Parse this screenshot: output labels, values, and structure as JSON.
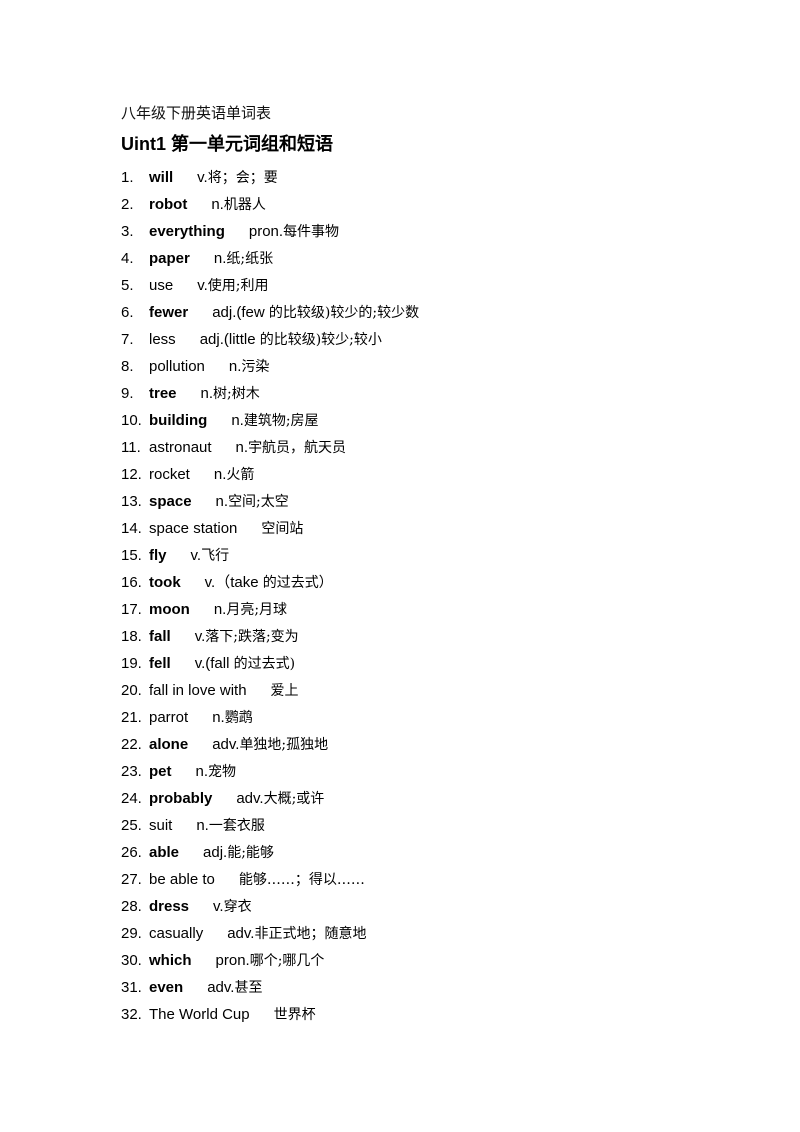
{
  "document": {
    "title": "八年级下册英语单词表",
    "unit_title_en": "Uint1",
    "unit_title_zh": "第一单元词组和短语",
    "entries": [
      {
        "num": "1.",
        "word": "will",
        "bold": true,
        "pos": "v.",
        "meaning": "将；会；要"
      },
      {
        "num": "2.",
        "word": "robot",
        "bold": true,
        "pos": "n.",
        "meaning": "机器人"
      },
      {
        "num": "3.",
        "word": "everything",
        "bold": true,
        "pos": "pron.",
        "meaning": "每件事物"
      },
      {
        "num": "4.",
        "word": "paper",
        "bold": true,
        "pos": "n.",
        "meaning": "纸;纸张"
      },
      {
        "num": "5.",
        "word": "use",
        "bold": false,
        "pos": "v.",
        "meaning": "使用;利用"
      },
      {
        "num": "6.",
        "word": "fewer",
        "bold": true,
        "pos": "adj.(few ",
        "meaning": "的比较级)较少的;较少数"
      },
      {
        "num": "7.",
        "word": "less",
        "bold": false,
        "pos": "adj.(little ",
        "meaning": "的比较级)较少;较小"
      },
      {
        "num": "8.",
        "word": "pollution",
        "bold": false,
        "pos": "n.",
        "meaning": "污染"
      },
      {
        "num": "9.",
        "word": "tree",
        "bold": true,
        "pos": "n.",
        "meaning": "树;树木"
      },
      {
        "num": "10.",
        "word": "building",
        "bold": true,
        "pos": "n.",
        "meaning": "建筑物;房屋"
      },
      {
        "num": "11.",
        "word": "astronaut",
        "bold": false,
        "pos": "n.",
        "meaning": "宇航员，航天员"
      },
      {
        "num": "12.",
        "word": "rocket",
        "bold": false,
        "pos": "n.",
        "meaning": "火箭"
      },
      {
        "num": "13.",
        "word": "space",
        "bold": true,
        "pos": "n.",
        "meaning": "空间;太空"
      },
      {
        "num": "14.",
        "word": "space station",
        "bold": false,
        "pos": "",
        "meaning": "空间站"
      },
      {
        "num": "15.",
        "word": "fly",
        "bold": true,
        "pos": "v.",
        "meaning": "飞行"
      },
      {
        "num": "16.",
        "word": "took",
        "bold": true,
        "pos": "v.（take ",
        "meaning": "的过去式）"
      },
      {
        "num": "17.",
        "word": "moon",
        "bold": true,
        "pos": "n.",
        "meaning": "月亮;月球"
      },
      {
        "num": "18.",
        "word": "fall",
        "bold": true,
        "pos": "v.",
        "meaning": "落下;跌落;变为"
      },
      {
        "num": "19.",
        "word": "fell",
        "bold": true,
        "pos": "v.(fall ",
        "meaning": "的过去式)"
      },
      {
        "num": "20.",
        "word": "fall in love with",
        "bold": false,
        "pos": "",
        "meaning": "爱上"
      },
      {
        "num": "21.",
        "word": "parrot",
        "bold": false,
        "pos": "n.",
        "meaning": "鹦鹉"
      },
      {
        "num": "22.",
        "word": "alone",
        "bold": true,
        "pos": "adv.",
        "meaning": "单独地;孤独地"
      },
      {
        "num": "23.",
        "word": "pet",
        "bold": true,
        "pos": "n.",
        "meaning": "宠物"
      },
      {
        "num": "24.",
        "word": "probably",
        "bold": true,
        "pos": "adv.",
        "meaning": "大概;或许"
      },
      {
        "num": "25.",
        "word": "suit",
        "bold": false,
        "pos": "n.",
        "meaning": "一套衣服"
      },
      {
        "num": "26.",
        "word": "able",
        "bold": true,
        "pos": "adj.",
        "meaning": "能;能够"
      },
      {
        "num": "27.",
        "word": "be able to",
        "bold": false,
        "pos": "",
        "meaning": "能够……；得以……"
      },
      {
        "num": "28.",
        "word": "dress",
        "bold": true,
        "pos": "v.",
        "meaning": "穿衣"
      },
      {
        "num": "29.",
        "word": "casually",
        "bold": false,
        "pos": "adv.",
        "meaning": "非正式地；随意地"
      },
      {
        "num": "30.",
        "word": "which",
        "bold": true,
        "pos": "pron.",
        "meaning": "哪个;哪几个"
      },
      {
        "num": "31.",
        "word": "even",
        "bold": true,
        "pos": "adv.",
        "meaning": "甚至"
      },
      {
        "num": "32.",
        "word": "The World Cup",
        "bold": false,
        "pos": "",
        "meaning": "世界杯"
      }
    ]
  }
}
